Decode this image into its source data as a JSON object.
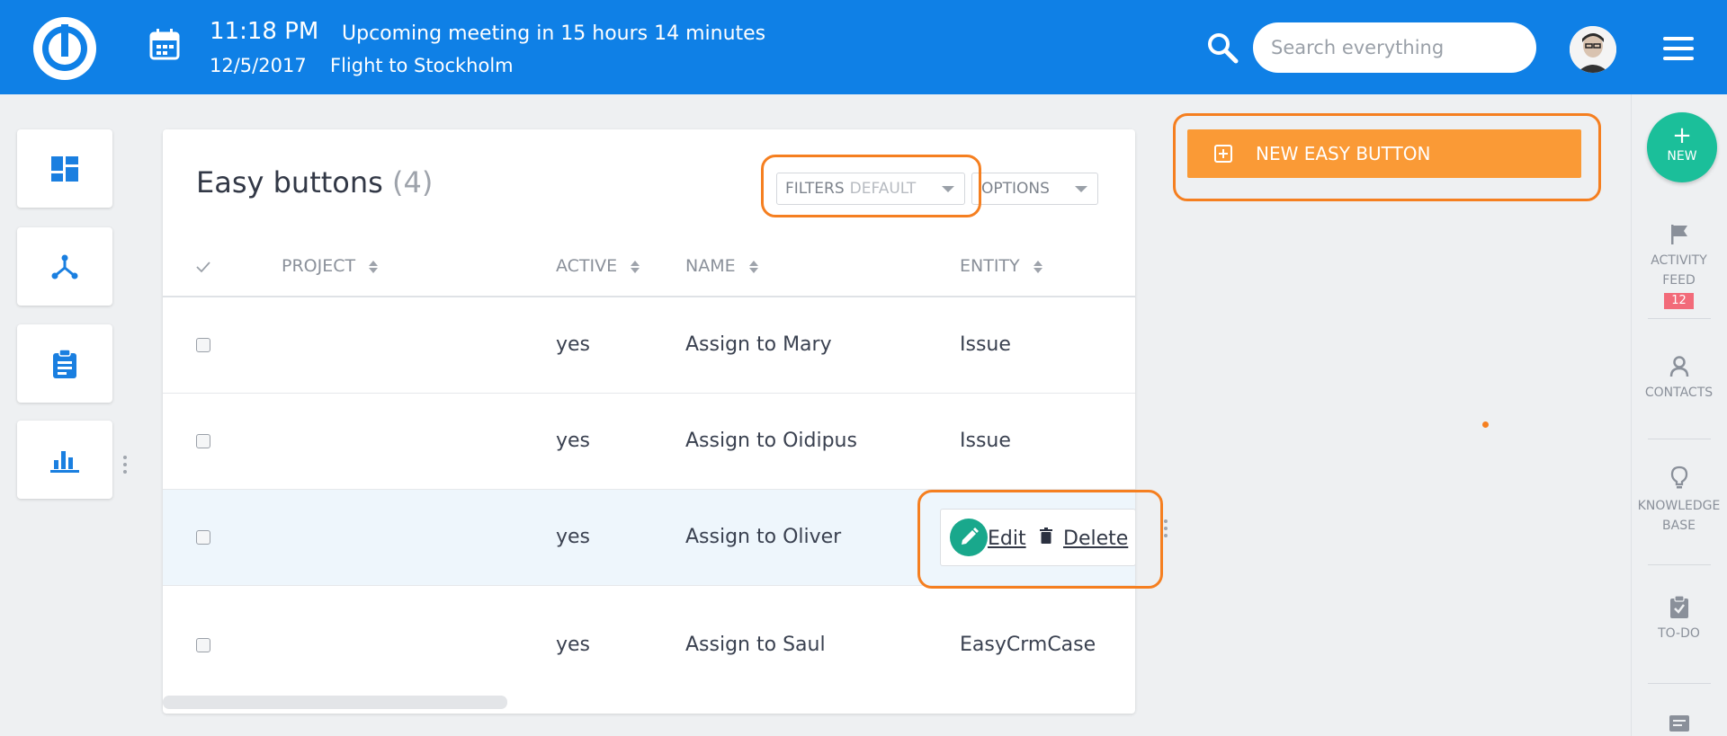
{
  "header": {
    "time": "11:18 PM",
    "meeting": "Upcoming meeting in 15 hours 14 minutes",
    "date": "12/5/2017",
    "event": "Flight to Stockholm",
    "search_placeholder": "Search everything"
  },
  "table": {
    "title": "Easy buttons",
    "count": "(4)",
    "filters_label": "FILTERS",
    "filters_value": "DEFAULT",
    "options_label": "OPTIONS",
    "columns": [
      "PROJECT",
      "ACTIVE",
      "NAME",
      "ENTITY"
    ],
    "rows": [
      {
        "project": "",
        "active": "yes",
        "name": "Assign to Mary",
        "entity": "Issue"
      },
      {
        "project": "",
        "active": "yes",
        "name": "Assign to Oidipus",
        "entity": "Issue"
      },
      {
        "project": "",
        "active": "yes",
        "name": "Assign to Oliver",
        "entity": ""
      },
      {
        "project": "",
        "active": "yes",
        "name": "Assign to Saul",
        "entity": "EasyCrmCase"
      }
    ],
    "actions": {
      "edit": "Edit",
      "delete": "Delete"
    }
  },
  "new_easy_button": "NEW EASY BUTTON",
  "rightbar": {
    "new_label": "NEW",
    "plus": "+",
    "activity_feed": [
      "ACTIVITY",
      "FEED"
    ],
    "activity_badge": "12",
    "contacts": "CONTACTS",
    "knowledge_base": [
      "KNOWLEDGE",
      "BASE"
    ],
    "todo": "TO-DO"
  },
  "colors": {
    "header_blue": "#0f80e6",
    "accent_orange": "#fa9a36",
    "highlight_orange": "#f57f20",
    "fab_green": "#1bbf9a",
    "edit_green": "#19a88c",
    "badge_pink": "#f26b7a"
  },
  "icons": {
    "logo": "logo-icon",
    "calendar": "calendar-icon",
    "search": "search-icon",
    "menu": "hamburger-icon",
    "left_nav": [
      "dashboard-icon",
      "hierarchy-icon",
      "clipboard-icon",
      "bar-chart-icon"
    ],
    "right_nav": [
      "flag-icon",
      "person-icon",
      "lightbulb-icon",
      "clipboard-check-icon",
      "comment-icon"
    ]
  }
}
